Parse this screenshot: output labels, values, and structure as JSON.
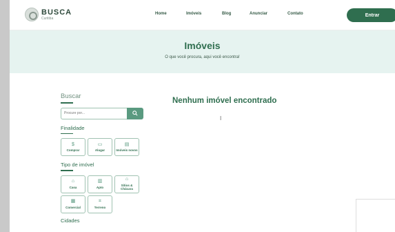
{
  "header": {
    "logo_main": "BUSCA",
    "logo_sub": "Curitiba",
    "nav": [
      "Home",
      "Imóveis",
      "Blog",
      "Anunciar",
      "Contato"
    ],
    "cta": "Entrar"
  },
  "hero": {
    "title": "Imóveis",
    "subtitle": "O que você procura, aqui você encontra!"
  },
  "sidebar": {
    "search_title": "Buscar",
    "search_placeholder": "Procure por...",
    "finalidade_title": "Finalidade",
    "finalidade": [
      {
        "label": "Comprar",
        "icon": "dollar-icon"
      },
      {
        "label": "Alugar",
        "icon": "calendar-icon"
      },
      {
        "label": "Imóveis novos",
        "icon": "building-icon"
      }
    ],
    "tipo_title": "Tipo de imóvel",
    "tipos": [
      {
        "label": "Casa",
        "icon": "house-icon"
      },
      {
        "label": "Apto",
        "icon": "apartment-icon"
      },
      {
        "label": "Sítios & Chácara",
        "icon": "farm-icon"
      },
      {
        "label": "Comercial",
        "icon": "store-icon"
      },
      {
        "label": "Terreno",
        "icon": "land-icon"
      }
    ],
    "cidades_title": "Cidades"
  },
  "main": {
    "message": "Nenhum imóvel encontrado"
  }
}
